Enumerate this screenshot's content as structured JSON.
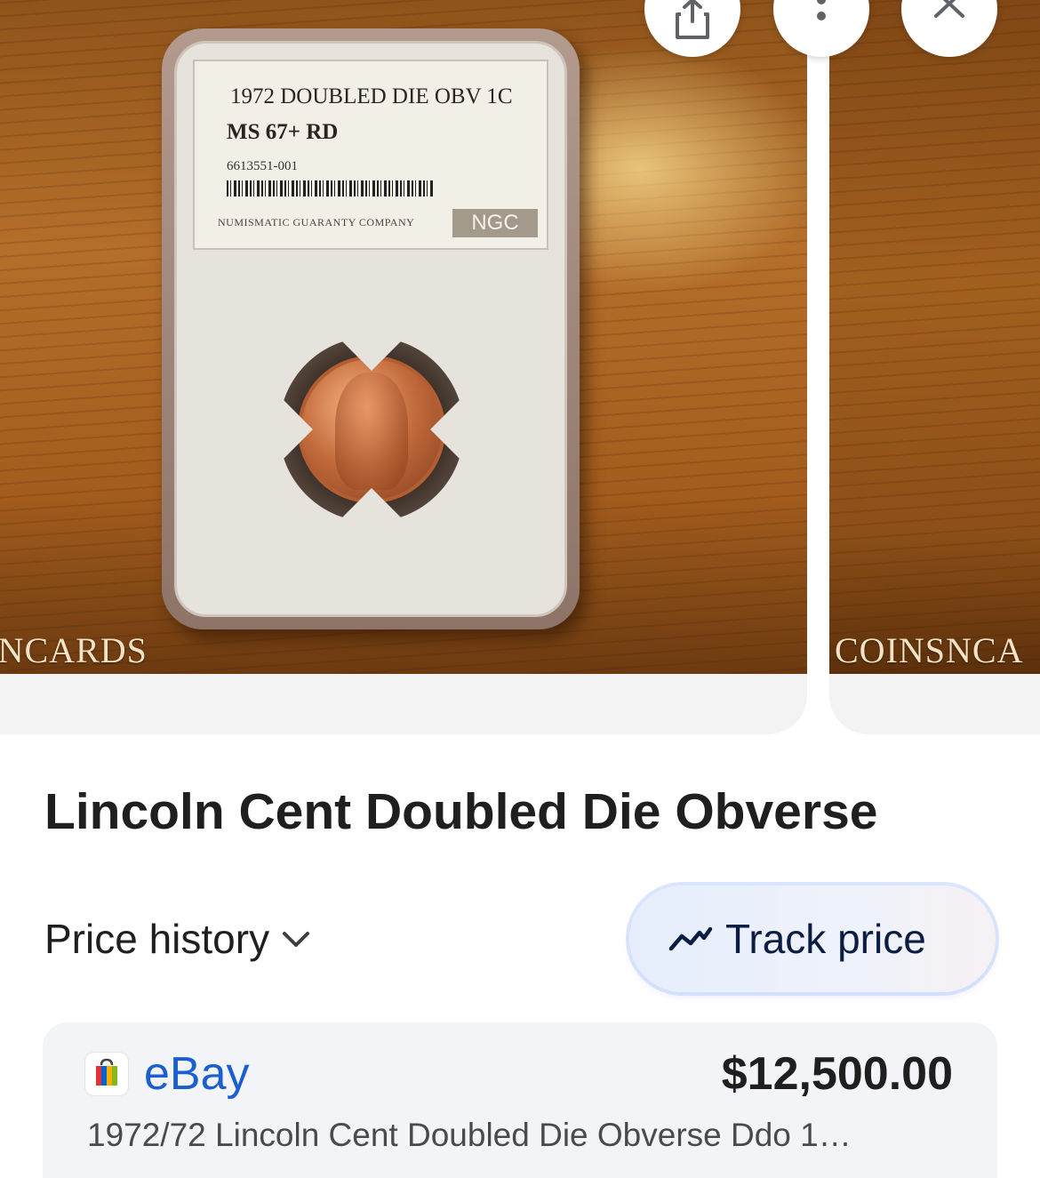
{
  "carousel": {
    "main_image": {
      "watermark": "ISNCARDS",
      "slab_label": {
        "line1": "1972 DOUBLED DIE OBV 1C",
        "grade": "MS 67+ RD",
        "cert_number": "6613551-001",
        "company": "NUMISMATIC GUARANTY COMPANY",
        "brand": "NGC"
      }
    },
    "next_image": {
      "watermark": "COINSNCA"
    }
  },
  "actions": {
    "share_icon": "share-icon",
    "more_icon": "more-vert-icon",
    "close_icon": "close-icon"
  },
  "product": {
    "title": "Lincoln Cent Doubled Die Obverse",
    "price_history_label": "Price history",
    "track_price_label": "Track price"
  },
  "offer": {
    "store": "eBay",
    "price": "$12,500.00",
    "description": "1972/72 Lincoln Cent Doubled Die Obverse Ddo 1…"
  },
  "colors": {
    "link_blue": "#1a5fd0",
    "track_text": "#0b1d42",
    "card_bg": "#f2f4f7"
  }
}
